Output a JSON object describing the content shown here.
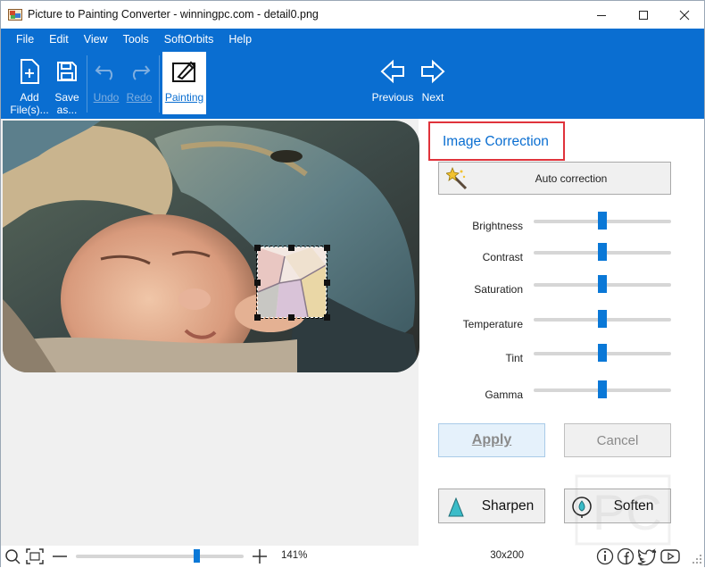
{
  "window": {
    "title": "Picture to Painting Converter - winningpc.com - detail0.png"
  },
  "menu": [
    {
      "label": "File",
      "icon": "none"
    },
    {
      "label": "Edit"
    },
    {
      "label": "View"
    },
    {
      "label": "Tools"
    },
    {
      "label": "SoftOrbits"
    },
    {
      "label": "Help"
    }
  ],
  "toolbar": {
    "add_files": "Add\nFile(s)...",
    "add_files_l1": "Add",
    "add_files_l2": "File(s)...",
    "save_l1": "Save",
    "save_l2": "as...",
    "undo": "Undo",
    "redo": "Redo",
    "painting": "Painting",
    "previous": "Previous",
    "next": "Next"
  },
  "panel": {
    "title": "Image Correction",
    "auto_correction": "Auto correction",
    "sliders": [
      {
        "label": "Brightness",
        "value": 0.5
      },
      {
        "label": "Contrast",
        "value": 0.5
      },
      {
        "label": "Saturation",
        "value": 0.5
      },
      {
        "label": "Temperature",
        "value": 0.5
      },
      {
        "label": "Tint",
        "value": 0.5
      },
      {
        "label": "Gamma",
        "value": 0.5
      }
    ],
    "apply": "Apply",
    "cancel": "Cancel",
    "sharpen": "Sharpen",
    "soften": "Soften"
  },
  "status": {
    "zoom": "141%",
    "zoom_slider_value": 0.72,
    "dimensions": "3​0x200",
    "dimensions_text": "30x200"
  },
  "colors": {
    "accent": "#0a6ed1",
    "highlight_border": "#e0333b",
    "slider_thumb": "#0a78d7"
  }
}
